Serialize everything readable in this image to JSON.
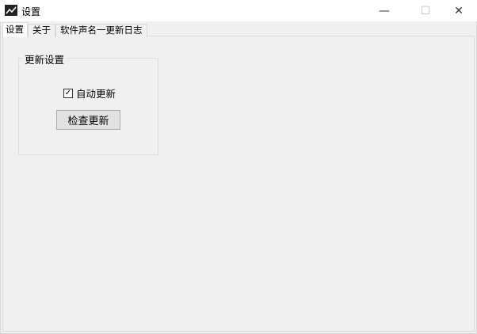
{
  "window": {
    "title": "设置",
    "icon": "picture-icon",
    "minimize": "—",
    "maximize": "☐",
    "close": "✕"
  },
  "tabs": [
    {
      "label": "设置"
    },
    {
      "label": "关于"
    },
    {
      "label": "软件声名一更新日志"
    }
  ],
  "group": {
    "title": "更新设置",
    "auto_update_label": "自动更新",
    "auto_update_checked": true,
    "check_mark": "✓",
    "check_button": "检查更新"
  }
}
